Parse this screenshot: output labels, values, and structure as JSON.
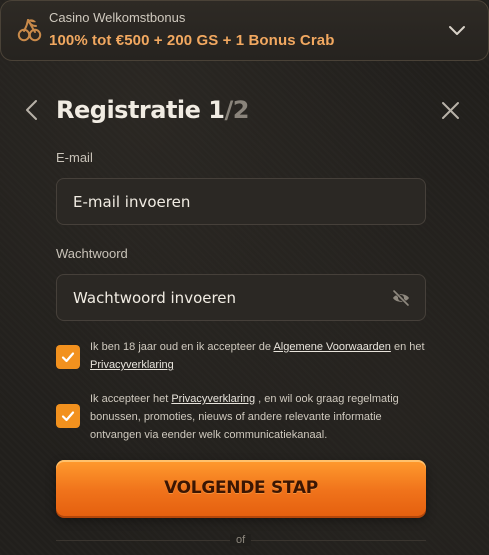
{
  "banner": {
    "subtitle": "Casino Welkomstbonus",
    "title": "100% tot €500 + 200 GS + 1 Bonus Crab",
    "icon": "cherries-icon",
    "accent": "#f2a860"
  },
  "header": {
    "step": "Registratie 1",
    "separator": "/",
    "total": "2",
    "back_icon": "chevron-left-icon",
    "close_icon": "close-icon"
  },
  "email": {
    "label": "E-mail",
    "placeholder": "E-mail invoeren"
  },
  "password": {
    "label": "Wachtwoord",
    "placeholder": "Wachtwoord invoeren",
    "toggle_icon": "eye-off-icon"
  },
  "consent1": {
    "checked": true,
    "text_before": "Ik ben 18 jaar oud en ik accepteer de ",
    "link1": "Algemene Voorwaarden",
    "text_middle": " en het ",
    "link2": "Privacyverklaring"
  },
  "consent2": {
    "checked": true,
    "text_before": "Ik accepteer het ",
    "link": "Privacyverklaring",
    "text_after": " , en wil ook graag regelmatig bonussen, promoties, nieuws of andere relevante informatie ontvangen via eender welk communicatiekanaal."
  },
  "cta": {
    "label": "VOLGENDE STAP",
    "color": "#f0731b"
  },
  "divider": {
    "label": "of"
  }
}
